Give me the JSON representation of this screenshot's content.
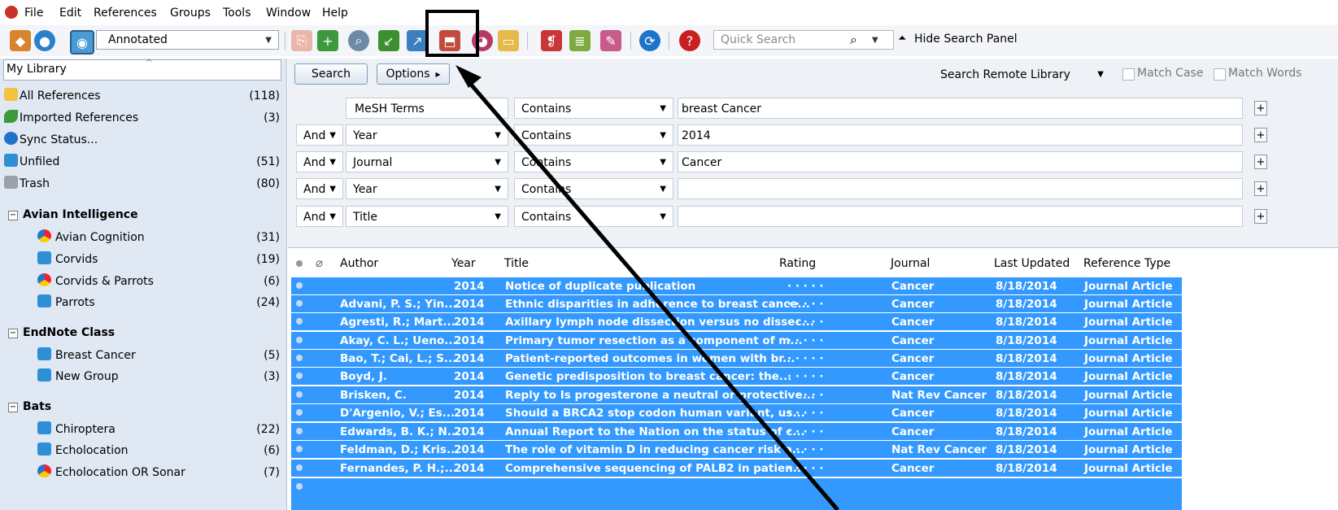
{
  "menu": [
    "File",
    "Edit",
    "References",
    "Groups",
    "Tools",
    "Window",
    "Help"
  ],
  "toolbar": {
    "group_value": "Annotated",
    "quick_search_placeholder": "Quick Search",
    "hide_search_panel": "Hide Search Panel"
  },
  "library": {
    "title": "My Library",
    "items": [
      {
        "label": "All References",
        "count": "(118)"
      },
      {
        "label": "Imported References",
        "count": "(3)"
      },
      {
        "label": "Sync Status...",
        "count": ""
      },
      {
        "label": "Unfiled",
        "count": "(51)"
      },
      {
        "label": "Trash",
        "count": "(80)"
      }
    ],
    "groups": [
      {
        "name": "Avian Intelligence",
        "items": [
          {
            "label": "Avian Cognition",
            "count": "(31)"
          },
          {
            "label": "Corvids",
            "count": "(19)"
          },
          {
            "label": "Corvids & Parrots",
            "count": "(6)"
          },
          {
            "label": "Parrots",
            "count": "(24)"
          }
        ]
      },
      {
        "name": "EndNote Class",
        "items": [
          {
            "label": "Breast Cancer",
            "count": "(5)"
          },
          {
            "label": "New Group",
            "count": "(3)"
          }
        ]
      },
      {
        "name": "Bats",
        "items": [
          {
            "label": "Chiroptera",
            "count": "(22)"
          },
          {
            "label": "Echolocation",
            "count": "(6)"
          },
          {
            "label": "Echolocation OR Sonar",
            "count": "(7)"
          }
        ]
      }
    ]
  },
  "search": {
    "search_btn": "Search",
    "options_btn": "Options",
    "options_arrow": "▸",
    "remote": "Search Remote Library",
    "match_case": "Match Case",
    "match_words": "Match Words",
    "rows": [
      {
        "bool": "",
        "field": "MeSH Terms",
        "op": "Contains",
        "value": "breast Cancer"
      },
      {
        "bool": "And",
        "field": "Year",
        "op": "Contains",
        "value": "2014"
      },
      {
        "bool": "And",
        "field": "Journal",
        "op": "Contains",
        "value": "Cancer"
      },
      {
        "bool": "And",
        "field": "Year",
        "op": "Contains",
        "value": ""
      },
      {
        "bool": "And",
        "field": "Title",
        "op": "Contains",
        "value": ""
      }
    ]
  },
  "table": {
    "columns": [
      "Author",
      "Year",
      "Title",
      "Rating",
      "Journal",
      "Last Updated",
      "Reference Type"
    ],
    "rows": [
      {
        "author": "",
        "year": "2014",
        "title": "Notice of duplicate publication",
        "rating": "· · · · ·",
        "journal": "Cancer",
        "updated": "8/18/2014",
        "type": "Journal Article"
      },
      {
        "author": "Advani, P. S.; Yin...",
        "year": "2014",
        "title": "Ethnic disparities in adherence to breast cance...",
        "rating": "· · · · ·",
        "journal": "Cancer",
        "updated": "8/18/2014",
        "type": "Journal Article"
      },
      {
        "author": "Agresti, R.; Mart...",
        "year": "2014",
        "title": "Axillary lymph node dissection versus no dissec...",
        "rating": "· · · · ·",
        "journal": "Cancer",
        "updated": "8/18/2014",
        "type": "Journal Article"
      },
      {
        "author": "Akay, C. L.; Ueno...",
        "year": "2014",
        "title": "Primary tumor resection as a component of m...",
        "rating": "· · · · ·",
        "journal": "Cancer",
        "updated": "8/18/2014",
        "type": "Journal Article"
      },
      {
        "author": "Bao, T.; Cai, L.; S...",
        "year": "2014",
        "title": "Patient-reported outcomes in women with br...",
        "rating": "· · · · ·",
        "journal": "Cancer",
        "updated": "8/18/2014",
        "type": "Journal Article"
      },
      {
        "author": "Boyd, J.",
        "year": "2014",
        "title": "Genetic predisposition to breast cancer: the...",
        "rating": "· · · · ·",
        "journal": "Cancer",
        "updated": "8/18/2014",
        "type": "Journal Article"
      },
      {
        "author": "Brisken, C.",
        "year": "2014",
        "title": "Reply to Is progesterone a neutral or protective...",
        "rating": "· · · · ·",
        "journal": "Nat Rev Cancer",
        "updated": "8/18/2014",
        "type": "Journal Article"
      },
      {
        "author": "D'Argenio, V.; Es...",
        "year": "2014",
        "title": "Should a BRCA2 stop codon human variant, us...",
        "rating": "· · · · ·",
        "journal": "Cancer",
        "updated": "8/18/2014",
        "type": "Journal Article"
      },
      {
        "author": "Edwards, B. K.; N...",
        "year": "2014",
        "title": "Annual Report to the Nation on the status of c...",
        "rating": "· · · · ·",
        "journal": "Cancer",
        "updated": "8/18/2014",
        "type": "Journal Article"
      },
      {
        "author": "Feldman, D.; Kris...",
        "year": "2014",
        "title": "The role of vitamin D in reducing cancer risk a...",
        "rating": "· · · · ·",
        "journal": "Nat Rev Cancer",
        "updated": "8/18/2014",
        "type": "Journal Article"
      },
      {
        "author": "Fernandes, P. H.;...",
        "year": "2014",
        "title": "Comprehensive sequencing of PALB2 in patien...",
        "rating": "· · · · ·",
        "journal": "Cancer",
        "updated": "8/18/2014",
        "type": "Journal Article"
      }
    ]
  },
  "colors": {
    "selection": "#3399ff",
    "accent": "#0a6fd8"
  }
}
